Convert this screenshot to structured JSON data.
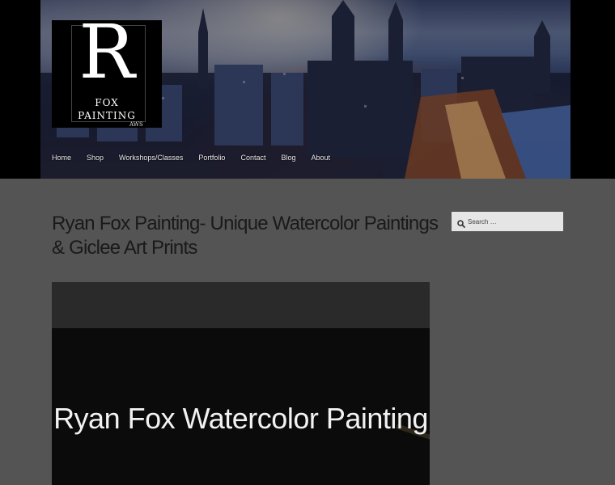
{
  "logo": {
    "letter": "R",
    "line1": "FOX",
    "line2": "PAINTING",
    "line3": "AWS"
  },
  "nav": {
    "items": [
      "Home",
      "Shop",
      "Workshops/Classes",
      "Portfolio",
      "Contact",
      "Blog",
      "About"
    ]
  },
  "page": {
    "title": "Ryan Fox Painting- Unique Watercolor Paintings & Giclee Art Prints"
  },
  "search": {
    "placeholder": "Search …",
    "icon": "search-icon"
  },
  "hero": {
    "title": "Ryan Fox Watercolor Painting"
  },
  "colors": {
    "background": "#545454",
    "header": "#000000",
    "search_bg": "#e5e5e5",
    "hero_bg": "#0b0b0b"
  }
}
